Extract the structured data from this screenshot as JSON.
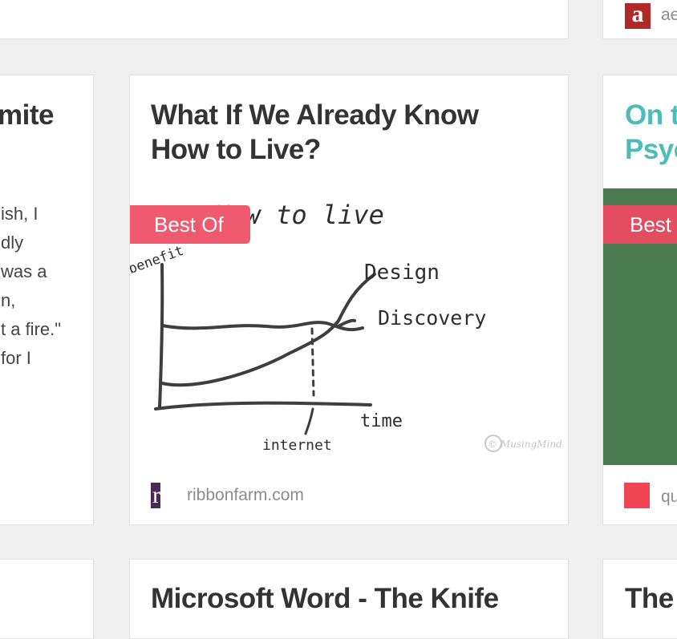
{
  "colors": {
    "page_background": "#efeff0",
    "card_background": "#ffffff",
    "title_text": "#333333",
    "title_link_teal": "#4bbcb7",
    "badge_background": "#f05a6e",
    "badge_background_dark": "#e24e5f",
    "source_text": "#8c8c8c",
    "green_image": "#4a7a50"
  },
  "top_row": {
    "right_card": {
      "source_icon": "a-letter-icon",
      "source_text_partial": "ae"
    }
  },
  "left_card": {
    "title_partial": "mite",
    "excerpt_lines": [
      "ish, I",
      "dly",
      "was a",
      "n,",
      "t a fire.\"",
      "for I"
    ]
  },
  "center_card": {
    "title_line1": "What If We Already Know",
    "title_line2": "How to Live?",
    "badge": "Best Of",
    "image_icon": "hand-drawn-graph-sketch",
    "sketch": {
      "title": "How to live",
      "y_axis": "benefit",
      "x_axis": "time",
      "curve_upper": "Design",
      "curve_lower": "Discovery",
      "marker": "internet",
      "watermark": "© MusingMind"
    },
    "source_icon": "rf-logo-icon",
    "source_icon_text": "rf",
    "source": "ribbonfarm.com"
  },
  "right_card": {
    "title_line1_partial": "On t",
    "title_line2_partial": "Psyc",
    "badge_partial": "Best",
    "source_icon": "red-square-icon",
    "source_text_partial": "qu"
  },
  "bottom_row": {
    "center_title": "Microsoft Word - The Knife",
    "right_title_partial": "The"
  }
}
